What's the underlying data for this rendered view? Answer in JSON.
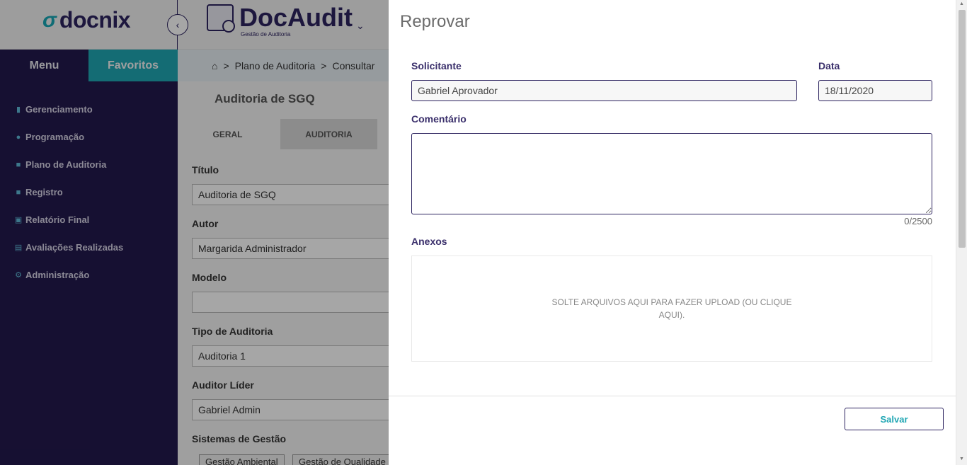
{
  "header": {
    "brand_mark": "σ",
    "brand": "docnix",
    "collapse_icon": "‹",
    "app_title": "DocAudit",
    "app_subtitle": "Gestão de Auditoria",
    "app_caret": "⌄"
  },
  "sidebar": {
    "tabs": [
      {
        "label": "Menu"
      },
      {
        "label": "Favoritos"
      }
    ],
    "items": [
      {
        "label": "Gerenciamento",
        "icon": "bar-chart-icon"
      },
      {
        "label": "Programação",
        "icon": "person-icon"
      },
      {
        "label": "Plano de Auditoria",
        "icon": "document-icon"
      },
      {
        "label": "Registro",
        "icon": "files-icon"
      },
      {
        "label": "Relatório Final",
        "icon": "report-icon"
      },
      {
        "label": "Avaliações Realizadas",
        "icon": "checklist-icon"
      },
      {
        "label": "Administração",
        "icon": "gear-icon"
      }
    ]
  },
  "main": {
    "breadcrumb": [
      "Plano de Auditoria",
      "Consultar"
    ],
    "card_title": "Auditoria de SGQ",
    "tabs": [
      "GERAL",
      "AUDITORIA"
    ],
    "fields": [
      {
        "label": "Título",
        "value": "Auditoria de SGQ"
      },
      {
        "label": "Autor",
        "value": "Margarida Administrador"
      },
      {
        "label": "Modelo",
        "value": ""
      },
      {
        "label": "Tipo de Auditoria",
        "value": "Auditoria 1"
      },
      {
        "label": "Auditor Líder",
        "value": "Gabriel Admin"
      }
    ],
    "systems_label": "Sistemas de Gestão",
    "systems": [
      "Gestão Ambiental",
      "Gestão de Qualidade"
    ]
  },
  "drawer": {
    "title": "Reprovar",
    "requester_label": "Solicitante",
    "requester_value": "Gabriel Aprovador",
    "date_label": "Data",
    "date_value": "18/11/2020",
    "comment_label": "Comentário",
    "comment_value": "",
    "comment_counter": "0/2500",
    "attachments_label": "Anexos",
    "dropzone_text": "SOLTE ARQUIVOS AQUI PARA FAZER UPLOAD (OU CLIQUE AQUI).",
    "save_label": "Salvar"
  }
}
